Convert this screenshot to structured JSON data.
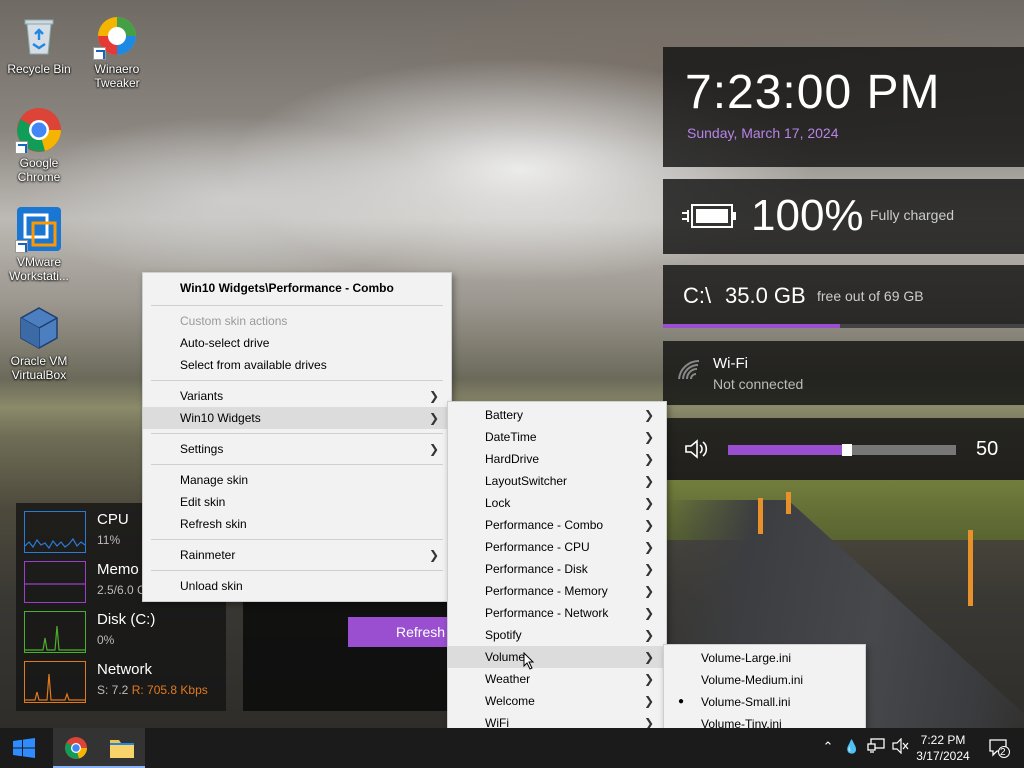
{
  "desktop_icons": [
    {
      "label": "Recycle Bin",
      "icon": "recycle-bin-icon"
    },
    {
      "label": "Winaero Tweaker",
      "icon": "winaero-tweaker-icon"
    },
    {
      "label": "Google Chrome",
      "icon": "chrome-icon"
    },
    {
      "label": "VMware Workstati...",
      "icon": "vmware-icon"
    },
    {
      "label": "Oracle VM VirtualBox",
      "icon": "virtualbox-icon"
    }
  ],
  "clock": {
    "time": "7:23:00 PM",
    "date": "Sunday, March 17, 2024"
  },
  "battery": {
    "percent": "100%",
    "status": "Fully charged"
  },
  "drive": {
    "letter": "C:\\",
    "size": "35.0 GB",
    "free": "free out of 69 GB",
    "used_fraction": 0.49
  },
  "wifi": {
    "name": "Wi-Fi",
    "status": "Not connected"
  },
  "volume": {
    "value": "50",
    "level": 0.5
  },
  "performance": [
    {
      "name": "CPU",
      "value": "11%",
      "color": "#2a7bd6"
    },
    {
      "name": "Memo",
      "value": "2.5/6.0 G",
      "color": "#9a3fc7"
    },
    {
      "name": "Disk (C:)",
      "value": "0%",
      "color": "#4caf2a"
    },
    {
      "name": "Network",
      "value_s": "S: 7.2",
      "value_r": "R: 705.8 Kbps",
      "color": "#e07a1c"
    }
  ],
  "partial_widget": {
    "button": "Refresh"
  },
  "menu_main": {
    "header": "Win10 Widgets\\Performance - Combo",
    "custom_actions": "Custom skin actions",
    "auto_select": "Auto-select drive",
    "select_drives": "Select from available drives",
    "variants": "Variants",
    "win10_widgets": "Win10 Widgets",
    "settings": "Settings",
    "manage_skin": "Manage skin",
    "edit_skin": "Edit skin",
    "refresh_skin": "Refresh skin",
    "rainmeter": "Rainmeter",
    "unload_skin": "Unload skin"
  },
  "menu_sub1": [
    "Battery",
    "DateTime",
    "HardDrive",
    "LayoutSwitcher",
    "Lock",
    "Performance - Combo",
    "Performance - CPU",
    "Performance - Disk",
    "Performance - Memory",
    "Performance - Network",
    "Spotify",
    "Volume",
    "Weather",
    "Welcome",
    "WiFi"
  ],
  "menu_sub2": [
    "Volume-Large.ini",
    "Volume-Medium.ini",
    "Volume-Small.ini",
    "Volume-Tiny.ini"
  ],
  "menu_sub2_selected": "Volume-Small.ini",
  "taskbar": {
    "time": "7:22 PM",
    "date": "3/17/2024",
    "notification_count": "2",
    "pinned": [
      "start-icon",
      "chrome-icon",
      "file-explorer-icon"
    ]
  }
}
